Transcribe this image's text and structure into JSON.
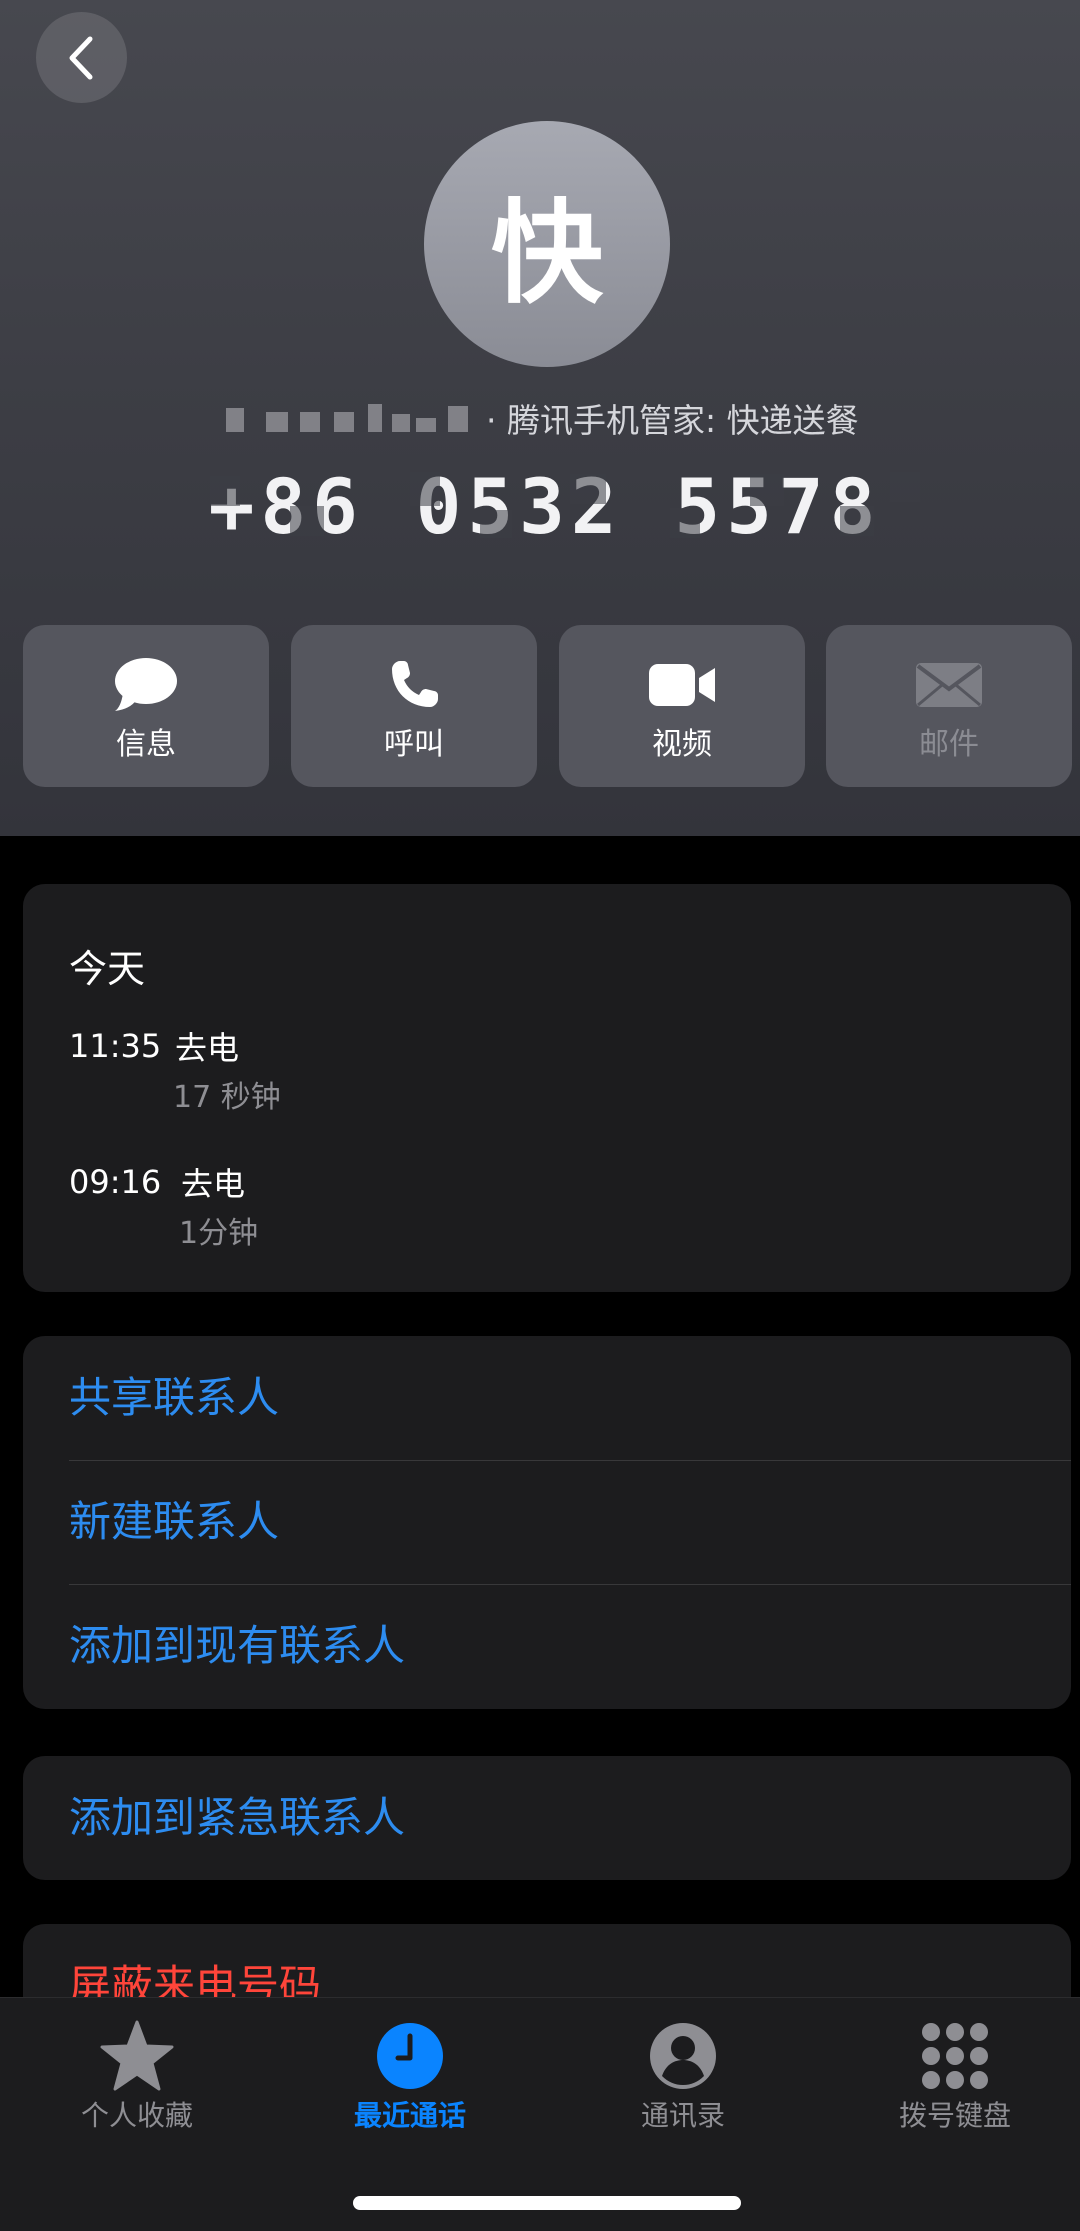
{
  "header": {
    "back_icon": "chevron-left-icon",
    "avatar_text": "快",
    "subtitle": "· 腾讯手机管家: 快递送餐",
    "phone_number": "+86 0532 5578"
  },
  "actions": [
    {
      "label": "信息",
      "icon": "message-bubble-icon",
      "enabled": true
    },
    {
      "label": "呼叫",
      "icon": "phone-icon",
      "enabled": true
    },
    {
      "label": "视频",
      "icon": "video-camera-icon",
      "enabled": true
    },
    {
      "label": "邮件",
      "icon": "mail-icon",
      "enabled": false
    }
  ],
  "history": {
    "day": "今天",
    "calls": [
      {
        "time": "11:35",
        "type": "去电",
        "duration": "17 秒钟"
      },
      {
        "time": "09:16",
        "type": "去电",
        "duration": "1分钟"
      }
    ]
  },
  "links": {
    "share_contact": "共享联系人",
    "new_contact": "新建联系人",
    "add_to_existing": "添加到现有联系人"
  },
  "emergency": {
    "add_emergency": "添加到紧急联系人"
  },
  "block": {
    "block_caller": "屏蔽来电号码"
  },
  "tabbar": [
    {
      "label": "个人收藏",
      "icon": "star-icon",
      "active": false
    },
    {
      "label": "最近通话",
      "icon": "clock-icon",
      "active": true
    },
    {
      "label": "通讯录",
      "icon": "contact-person-icon",
      "active": false
    },
    {
      "label": "拨号键盘",
      "icon": "keypad-icon",
      "active": false
    }
  ],
  "colors": {
    "accent_blue": "#0a84ff",
    "link_blue": "#2d8cf0",
    "destructive_red": "#ff453a",
    "card_background": "#1c1c1e"
  }
}
